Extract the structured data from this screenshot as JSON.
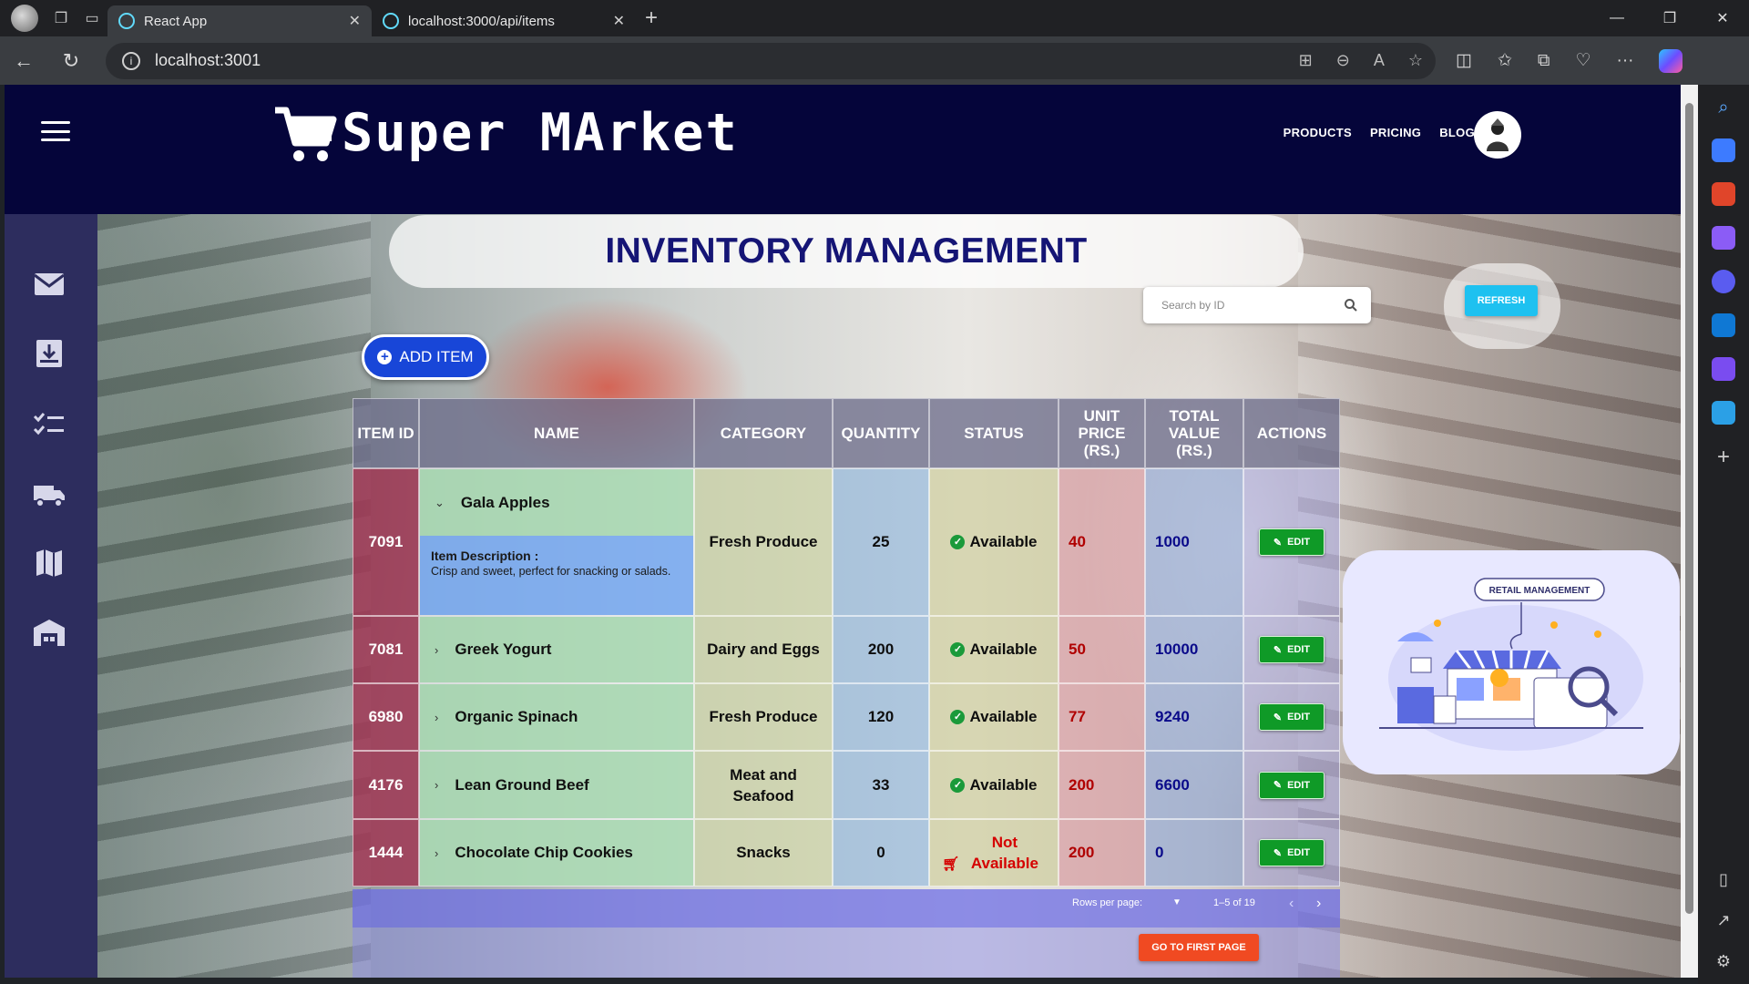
{
  "browser": {
    "tabs": [
      {
        "title": "React App",
        "active": true
      },
      {
        "title": "localhost:3000/api/items",
        "active": false
      }
    ],
    "url": "localhost:3001"
  },
  "header": {
    "logo_text": "Super MArket",
    "nav": [
      "PRODUCTS",
      "PRICING",
      "BLOG"
    ]
  },
  "sidebar_icons": [
    "mail-icon",
    "archive-download-icon",
    "checklist-icon",
    "truck-icon",
    "map-icon",
    "warehouse-icon"
  ],
  "page_title": "INVENTORY MANAGEMENT",
  "search": {
    "placeholder": "Search by ID"
  },
  "refresh_label": "REFRESH",
  "add_item_label": "ADD ITEM",
  "table": {
    "headers": {
      "id": "ITEM ID",
      "name": "NAME",
      "category": "CATEGORY",
      "quantity": "QUANTITY",
      "status": "STATUS",
      "unit_price": "UNIT PRICE (RS.)",
      "total_value": "TOTAL VALUE (RS.)",
      "actions": "ACTIONS"
    },
    "edit_label": "EDIT",
    "rows": [
      {
        "id": "7091",
        "name": "Gala Apples",
        "category": "Fresh Produce",
        "quantity": "25",
        "status": "Available",
        "unit_price": "40",
        "total_value": "1000",
        "expanded": true,
        "desc_label": "Item Description :",
        "description": "Crisp and sweet, perfect for snacking or salads."
      },
      {
        "id": "7081",
        "name": "Greek Yogurt",
        "category": "Dairy and Eggs",
        "quantity": "200",
        "status": "Available",
        "unit_price": "50",
        "total_value": "10000"
      },
      {
        "id": "6980",
        "name": "Organic Spinach",
        "category": "Fresh Produce",
        "quantity": "120",
        "status": "Available",
        "unit_price": "77",
        "total_value": "9240"
      },
      {
        "id": "4176",
        "name": "Lean Ground Beef",
        "category": "Meat and Seafood",
        "quantity": "33",
        "status": "Available",
        "unit_price": "200",
        "total_value": "6600"
      },
      {
        "id": "1444",
        "name": "Chocolate Chip Cookies",
        "category": "Snacks",
        "quantity": "0",
        "status": "Not Available",
        "unit_price": "200",
        "total_value": "0"
      }
    ]
  },
  "pagination": {
    "rows_per_page_label": "Rows per page:",
    "range": "1–5 of 19"
  },
  "first_page_label": "GO TO FIRST PAGE",
  "retail_card_label": "RETAIL MANAGEMENT",
  "colors": {
    "accent_blue": "#1846d8",
    "refresh": "#1ec1f0",
    "edit": "#0f9a27",
    "first_page": "#f04a22",
    "title": "#151575",
    "appbar": "#05053a"
  }
}
